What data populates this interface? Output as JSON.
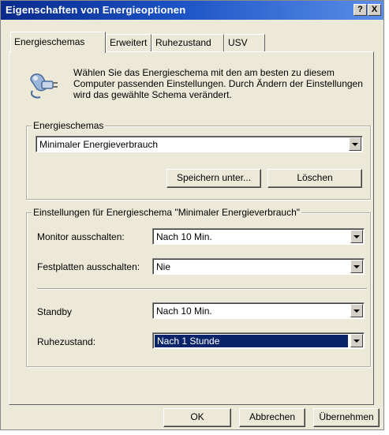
{
  "window": {
    "title": "Eigenschaften von Energieoptionen",
    "help_label": "?",
    "close_label": "X"
  },
  "tabs": [
    {
      "label": "Energieschemas",
      "active": true
    },
    {
      "label": "Erweitert"
    },
    {
      "label": "Ruhezustand"
    },
    {
      "label": "USV"
    }
  ],
  "intro": {
    "icon": "power-plug-icon",
    "text": "Wählen Sie das Energieschema mit den am besten zu diesem Computer passenden Einstellungen. Durch Ändern der Einstellungen wird das gewählte Schema verändert."
  },
  "schemes": {
    "legend": "Energieschemas",
    "selected": "Minimaler Energieverbrauch",
    "save_as_button": "Speichern unter...",
    "delete_button": "Löschen"
  },
  "settings": {
    "legend": "Einstellungen für Energieschema \"Minimaler Energieverbrauch\"",
    "monitor": {
      "label": "Monitor ausschalten:",
      "value": "Nach 10 Min."
    },
    "harddisks": {
      "label": "Festplatten ausschalten:",
      "value": "Nie"
    },
    "standby": {
      "label": "Standby",
      "value": "Nach 10 Min."
    },
    "hibernate": {
      "label": "Ruhezustand:",
      "value": "Nach 1 Stunde"
    }
  },
  "footer": {
    "ok": "OK",
    "cancel": "Abbrechen",
    "apply": "Übernehmen"
  },
  "colors": {
    "title_bar": "#0a2a8c",
    "dialog_face": "#ece9d8",
    "selection": "#0a246a"
  }
}
